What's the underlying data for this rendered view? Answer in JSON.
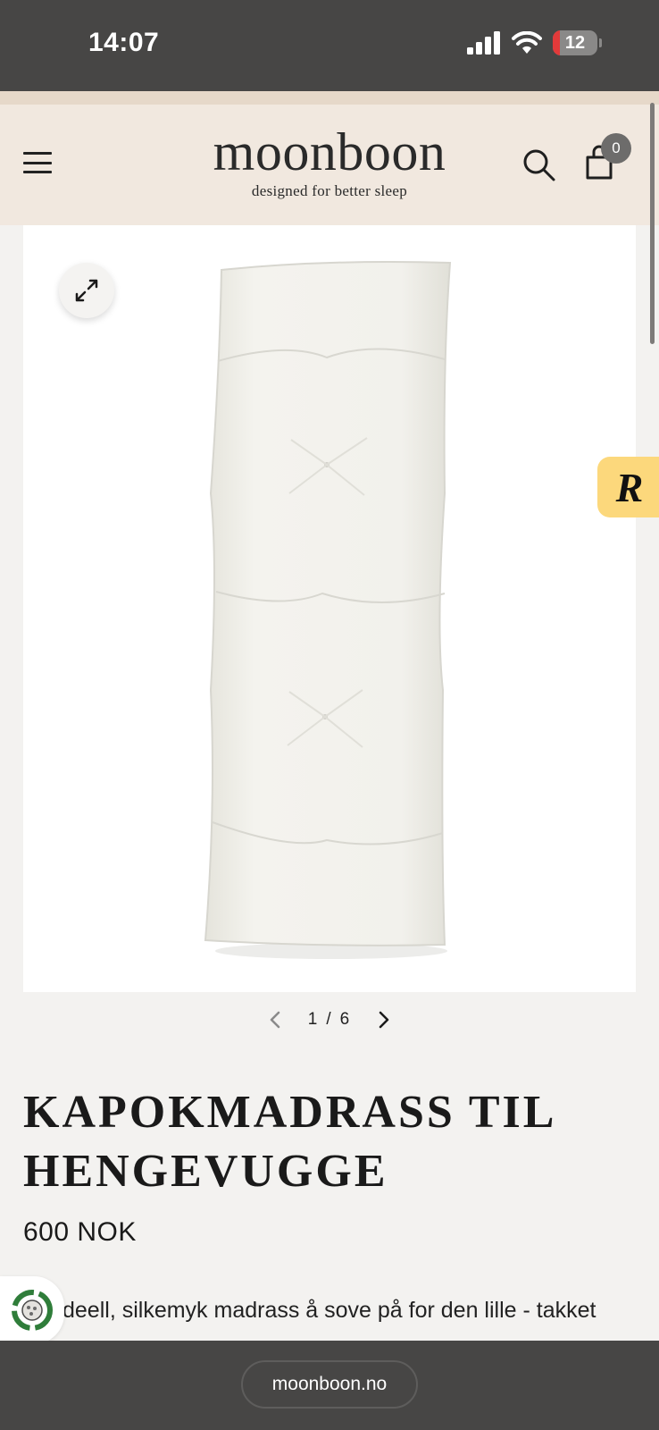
{
  "status_bar": {
    "time": "14:07",
    "battery_level": "12"
  },
  "header": {
    "logo_name": "moonboon",
    "logo_tagline": "designed for better sleep",
    "cart_count": "0"
  },
  "gallery": {
    "current": "1",
    "separator": "/",
    "total": "6"
  },
  "reviews_widget": {
    "letter": "R"
  },
  "product": {
    "title": "KAPOKMADRASS TIL HENGEVUGGE",
    "price": "600 NOK",
    "description": "deell, silkemyk madrass å sove på for den lille - takket"
  },
  "browser": {
    "url": "moonboon.no"
  },
  "colors": {
    "status_bar": "#474645",
    "header_bg": "#f1e8df",
    "page_bg": "#f3f2f0",
    "reviews_tab": "#fcd87c"
  }
}
